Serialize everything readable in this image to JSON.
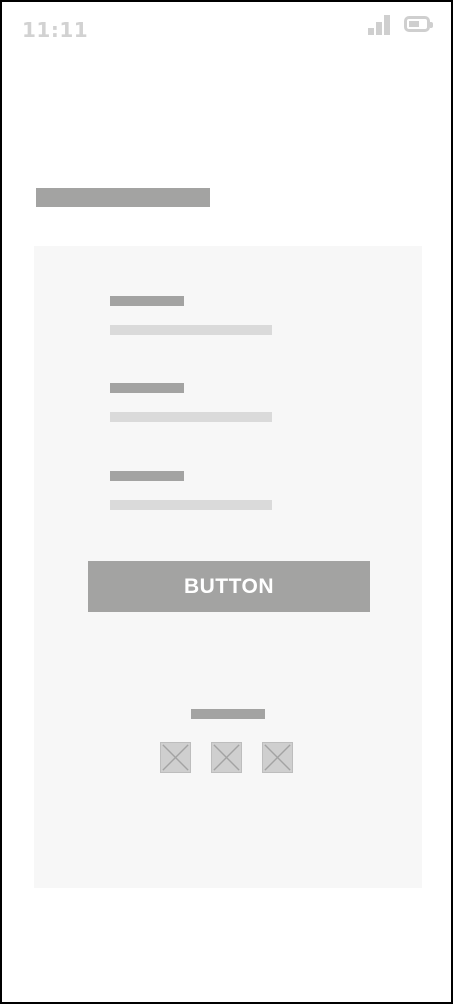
{
  "status_bar": {
    "time": "11:11",
    "icons": [
      "signal-icon",
      "battery-icon"
    ],
    "icon_color": "#cfcfcf"
  },
  "form": {
    "fields": [
      {
        "name": "field-1"
      },
      {
        "name": "field-2"
      },
      {
        "name": "field-3"
      }
    ],
    "submit_label": "BUTTON"
  },
  "social": {
    "icons": [
      "image-placeholder-icon",
      "image-placeholder-icon",
      "image-placeholder-icon"
    ]
  },
  "colors": {
    "placeholder_dark": "#a3a3a2",
    "placeholder_light": "#dadada",
    "card_background": "#f7f7f7",
    "frame_border": "#000000"
  }
}
